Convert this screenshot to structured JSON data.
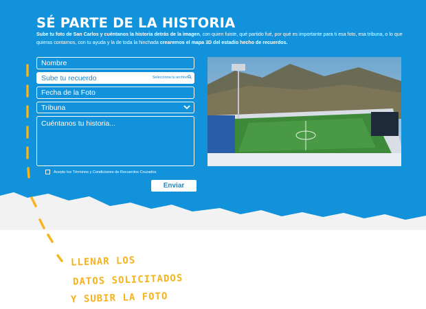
{
  "title": "SÉ PARTE DE LA HISTORIA",
  "intro": {
    "bold1": "Sube tu foto de San Carlos y cuéntanos la historia detrás de la imagen",
    "text1": ", con quien fuiste, qué partido fué, por qué es importante para ti esa foto, esa tribuna, o lo que quieras contarnos, con tu ayuda y la de toda la hinchada ",
    "bold2": "crearemos el mapa 3D del estadio hecho de recuerdos."
  },
  "form": {
    "name_placeholder": "Nombre",
    "upload_label": "Sube tu recuerdo",
    "upload_hint": "Selecciona tu archivo",
    "date_placeholder": "Fecha de la Foto",
    "tribuna_value": "Tribuna",
    "story_placeholder": "Cuéntanos tu historia...",
    "terms_label": "Acepto los Términos y Condiciones de Recuerdos Cruzados",
    "send_label": "Enviar"
  },
  "handwritten": {
    "line1": "LLENAR LOS",
    "line2": "DATOS SOLICITADOS",
    "line3": "Y SUBIR LA FOTO"
  },
  "colors": {
    "brand_blue": "#1192db",
    "annotation_yellow": "#f6b31d"
  },
  "icons": [
    "search-icon",
    "chevron-down-icon",
    "stadium-photo"
  ]
}
